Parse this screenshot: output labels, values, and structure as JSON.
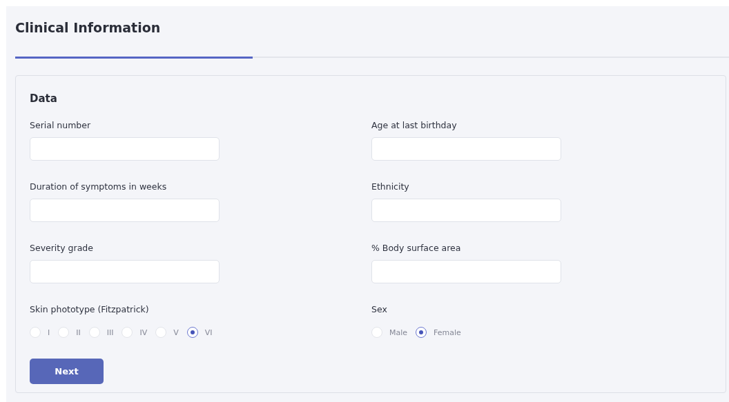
{
  "page": {
    "title": "Clinical Information"
  },
  "progress": {
    "level": 0.333
  },
  "card": {
    "title": "Data",
    "columns": [
      [
        {
          "kind": "text",
          "label": "Serial number"
        },
        {
          "kind": "text",
          "label": "Duration of symptoms in weeks"
        },
        {
          "kind": "text",
          "label": "Severity grade"
        },
        {
          "kind": "radio",
          "label": "Skin phototype (Fitzpatrick)",
          "options": [
            {
              "label": "I",
              "selected": false
            },
            {
              "label": "II",
              "selected": false
            },
            {
              "label": "III",
              "selected": false
            },
            {
              "label": "IV",
              "selected": false
            },
            {
              "label": "V",
              "selected": false
            },
            {
              "label": "VI",
              "selected": true
            }
          ]
        }
      ],
      [
        {
          "kind": "text",
          "label": "Age at last birthday"
        },
        {
          "kind": "text",
          "label": "Ethnicity"
        },
        {
          "kind": "text",
          "label": "% Body surface area"
        },
        {
          "kind": "radio",
          "label": "Sex",
          "options": [
            {
              "label": "Male",
              "selected": false
            },
            {
              "label": "Female",
              "selected": true
            }
          ]
        }
      ]
    ],
    "button": "Next"
  }
}
